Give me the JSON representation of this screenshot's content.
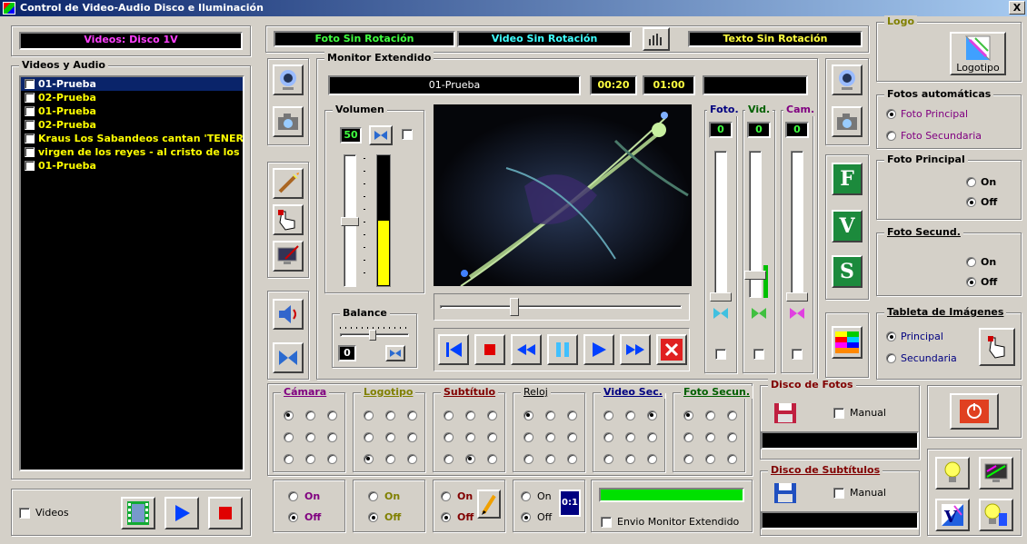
{
  "window": {
    "title": "Control de  Video-Audio Disco e Iluminación",
    "close_label": "X"
  },
  "left": {
    "display": "Videos: Disco 1V",
    "list_title": "Videos y Audio",
    "items": [
      "01-Prueba",
      "02-Prueba",
      "01-Prueba",
      "02-Prueba",
      "Kraus  Los Sabandeos cantan 'TENERIF",
      "virgen de los reyes - al cristo de los faro",
      "01-Prueba"
    ],
    "videos_label": "Videos"
  },
  "top_status": {
    "photo": "Foto Sin Rotación",
    "video": "Video Sin Rotación",
    "text": "Texto Sin Rotación"
  },
  "monitor": {
    "title": "Monitor Extendido",
    "track": "01-Prueba",
    "time_current": "00:20",
    "time_total": "01:00",
    "volume_title": "Volumen",
    "volume_value": "50",
    "volume_level": 0.5,
    "balance_title": "Balance",
    "balance_value": "0",
    "position": 0.3
  },
  "faders": {
    "foto_label": "Foto.",
    "foto_value": "0",
    "vid_label": "Vid.",
    "vid_value": "0",
    "cam_label": "Cam.",
    "cam_value": "0"
  },
  "letters": {
    "f": "F",
    "v": "V",
    "s": "S"
  },
  "bottom_groups": [
    {
      "title": "Cámara",
      "color": "#800080",
      "sel": 0
    },
    {
      "title": "Logotipo",
      "color": "#808000",
      "sel": 6
    },
    {
      "title": "Subtítulo",
      "color": "#800000",
      "sel": 7
    },
    {
      "title": "Reloj",
      "color": "#000000",
      "sel": 0
    },
    {
      "title": "Video Sec.",
      "color": "#000080",
      "sel": 2
    },
    {
      "title": "Foto Secun.",
      "color": "#006000",
      "sel": 0
    }
  ],
  "onoff": {
    "on": "On",
    "off": "Off"
  },
  "clock_icon": "0:1",
  "envio_label": "Envio Monitor Extendido",
  "right": {
    "logo_title": "Logo",
    "logo_button": "Logotipo",
    "fotos_auto_title": "Fotos automáticas",
    "foto_principal": "Foto Principal",
    "foto_secundaria": "Foto Secundaria",
    "foto_principal_group": "Foto Principal",
    "foto_secund_group": "Foto Secund.",
    "tableta_title": "Tableta de Imágenes",
    "principal": "Principal",
    "secundaria": "Secundaria",
    "disco_fotos": "Disco de Fotos",
    "disco_subtitulos": "Disco de Subtítulos",
    "manual": "Manual"
  }
}
